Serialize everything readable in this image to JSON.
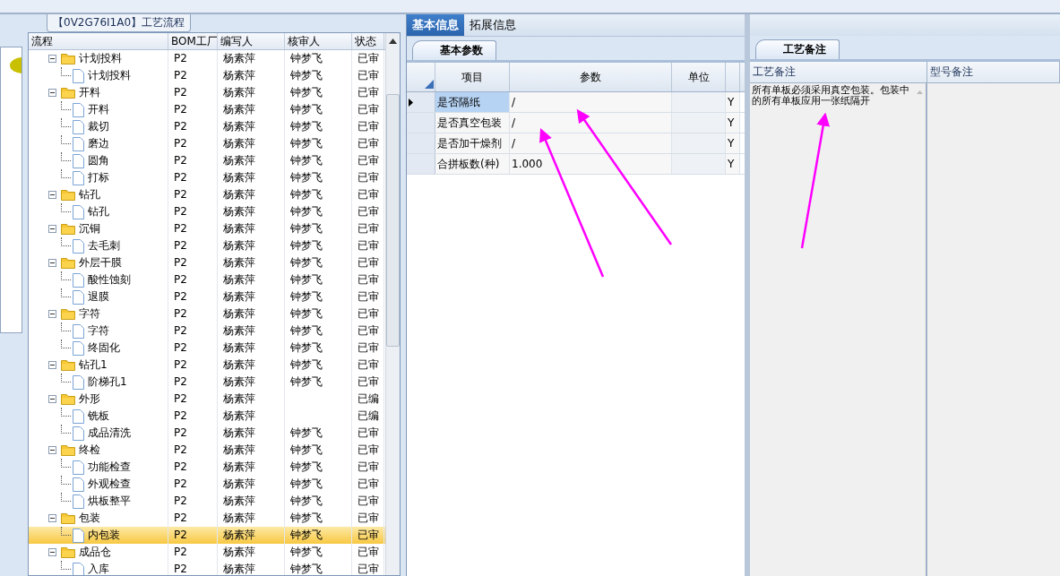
{
  "panel_title": "【0V2G76I1A0】工艺流程",
  "tree": {
    "columns": [
      "流程",
      "BOM工厂",
      "编写人",
      "核审人",
      "状态"
    ],
    "groups": [
      {
        "name": "计划投料",
        "bom": "P2",
        "writer": "杨素萍",
        "reviewer": "钟梦飞",
        "status": "已审",
        "selected": false,
        "expanded": true,
        "children": [
          {
            "name": "计划投料",
            "bom": "P2",
            "writer": "杨素萍",
            "reviewer": "钟梦飞",
            "status": "已审",
            "selected": false
          }
        ]
      },
      {
        "name": "开料",
        "bom": "P2",
        "writer": "杨素萍",
        "reviewer": "钟梦飞",
        "status": "已审",
        "selected": false,
        "expanded": true,
        "children": [
          {
            "name": "开料",
            "bom": "P2",
            "writer": "杨素萍",
            "reviewer": "钟梦飞",
            "status": "已审",
            "selected": false
          },
          {
            "name": "裁切",
            "bom": "P2",
            "writer": "杨素萍",
            "reviewer": "钟梦飞",
            "status": "已审",
            "selected": false
          },
          {
            "name": "磨边",
            "bom": "P2",
            "writer": "杨素萍",
            "reviewer": "钟梦飞",
            "status": "已审",
            "selected": false
          },
          {
            "name": "圆角",
            "bom": "P2",
            "writer": "杨素萍",
            "reviewer": "钟梦飞",
            "status": "已审",
            "selected": false
          },
          {
            "name": "打标",
            "bom": "P2",
            "writer": "杨素萍",
            "reviewer": "钟梦飞",
            "status": "已审",
            "selected": false
          }
        ]
      },
      {
        "name": "钻孔",
        "bom": "P2",
        "writer": "杨素萍",
        "reviewer": "钟梦飞",
        "status": "已审",
        "selected": false,
        "expanded": true,
        "children": [
          {
            "name": "钻孔",
            "bom": "P2",
            "writer": "杨素萍",
            "reviewer": "钟梦飞",
            "status": "已审",
            "selected": false
          }
        ]
      },
      {
        "name": "沉铜",
        "bom": "P2",
        "writer": "杨素萍",
        "reviewer": "钟梦飞",
        "status": "已审",
        "selected": false,
        "expanded": true,
        "children": [
          {
            "name": "去毛刺",
            "bom": "P2",
            "writer": "杨素萍",
            "reviewer": "钟梦飞",
            "status": "已审",
            "selected": false
          }
        ]
      },
      {
        "name": "外层干膜",
        "bom": "P2",
        "writer": "杨素萍",
        "reviewer": "钟梦飞",
        "status": "已审",
        "selected": false,
        "expanded": true,
        "children": [
          {
            "name": "酸性蚀刻",
            "bom": "P2",
            "writer": "杨素萍",
            "reviewer": "钟梦飞",
            "status": "已审",
            "selected": false
          },
          {
            "name": "退膜",
            "bom": "P2",
            "writer": "杨素萍",
            "reviewer": "钟梦飞",
            "status": "已审",
            "selected": false
          }
        ]
      },
      {
        "name": "字符",
        "bom": "P2",
        "writer": "杨素萍",
        "reviewer": "钟梦飞",
        "status": "已审",
        "selected": false,
        "expanded": true,
        "children": [
          {
            "name": "字符",
            "bom": "P2",
            "writer": "杨素萍",
            "reviewer": "钟梦飞",
            "status": "已审",
            "selected": false
          },
          {
            "name": "终固化",
            "bom": "P2",
            "writer": "杨素萍",
            "reviewer": "钟梦飞",
            "status": "已审",
            "selected": false
          }
        ]
      },
      {
        "name": "钻孔1",
        "bom": "P2",
        "writer": "杨素萍",
        "reviewer": "钟梦飞",
        "status": "已审",
        "selected": false,
        "expanded": true,
        "children": [
          {
            "name": "阶梯孔1",
            "bom": "P2",
            "writer": "杨素萍",
            "reviewer": "钟梦飞",
            "status": "已审",
            "selected": false
          }
        ]
      },
      {
        "name": "外形",
        "bom": "P2",
        "writer": "杨素萍",
        "status": "已编",
        "selected": false,
        "expanded": true,
        "children": [
          {
            "name": "铣板",
            "bom": "P2",
            "writer": "杨素萍",
            "status": "已编",
            "selected": false
          },
          {
            "name": "成品清洗",
            "bom": "P2",
            "writer": "杨素萍",
            "reviewer": "钟梦飞",
            "status": "已审",
            "selected": false
          }
        ]
      },
      {
        "name": "终检",
        "bom": "P2",
        "writer": "杨素萍",
        "reviewer": "钟梦飞",
        "status": "已审",
        "selected": false,
        "expanded": true,
        "children": [
          {
            "name": "功能检查",
            "bom": "P2",
            "writer": "杨素萍",
            "reviewer": "钟梦飞",
            "status": "已审",
            "selected": false
          },
          {
            "name": "外观检查",
            "bom": "P2",
            "writer": "杨素萍",
            "reviewer": "钟梦飞",
            "status": "已审",
            "selected": false
          },
          {
            "name": "烘板整平",
            "bom": "P2",
            "writer": "杨素萍",
            "reviewer": "钟梦飞",
            "status": "已审",
            "selected": false
          }
        ]
      },
      {
        "name": "包装",
        "bom": "P2",
        "writer": "杨素萍",
        "reviewer": "钟梦飞",
        "status": "已审",
        "selected": false,
        "expanded": true,
        "children": [
          {
            "name": "内包装",
            "bom": "P2",
            "writer": "杨素萍",
            "reviewer": "钟梦飞",
            "status": "已审",
            "selected": true
          }
        ]
      },
      {
        "name": "成品仓",
        "bom": "P2",
        "writer": "杨素萍",
        "reviewer": "钟梦飞",
        "status": "已审",
        "selected": false,
        "expanded": true,
        "children": [
          {
            "name": "入库",
            "bom": "P2",
            "writer": "杨素萍",
            "reviewer": "钟梦飞",
            "status": "已审",
            "selected": false
          }
        ]
      }
    ]
  },
  "tabs": [
    {
      "label": "基本信息",
      "selected": true
    },
    {
      "label": "拓展信息",
      "selected": false
    }
  ],
  "params": {
    "tab": "基本参数",
    "columns": [
      "项目",
      "参数",
      "单位"
    ],
    "rows": [
      {
        "item": "是否隔纸",
        "value": "/",
        "column_4": "Y",
        "selected": true
      },
      {
        "item": "是否真空包装",
        "value": "/",
        "column_4": "Y",
        "selected": false
      },
      {
        "item": "是否加干燥剂",
        "value": "/",
        "column_4": "Y",
        "selected": false
      },
      {
        "item": "合拼板数(种)",
        "value": "1.000",
        "column_4": "Y",
        "selected": false
      }
    ]
  },
  "notes": {
    "tab": "工艺备注",
    "columns": [
      "工艺备注",
      "型号备注"
    ],
    "process_note": "所有单板必须采用真空包装。包装中的所有单板应用一张纸隔开"
  }
}
